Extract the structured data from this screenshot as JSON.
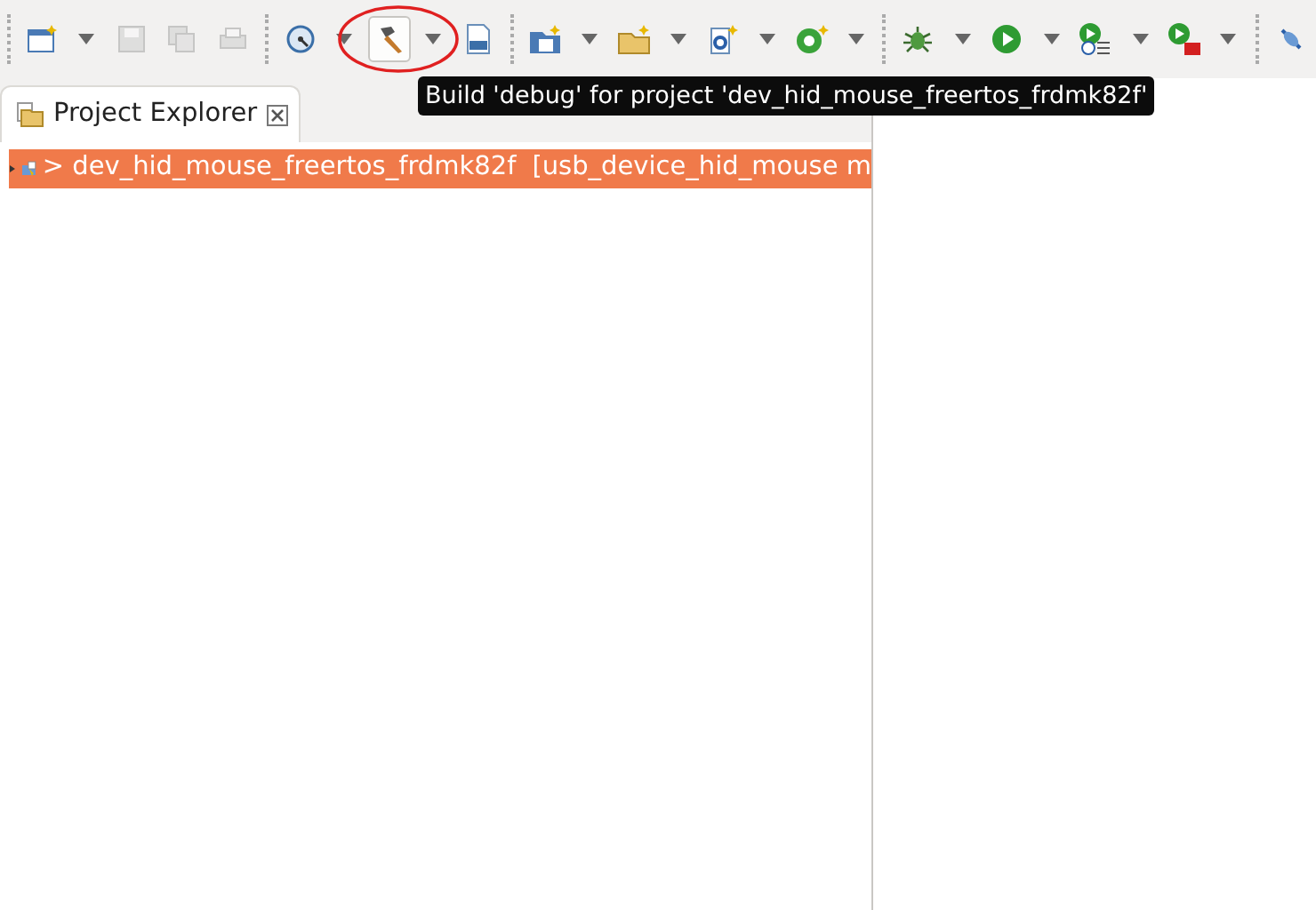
{
  "toolbar": [
    {
      "kind": "separator"
    },
    {
      "kind": "button",
      "disabled": false,
      "hovered": false
    },
    {
      "kind": "caret"
    },
    {
      "kind": "button",
      "disabled": true,
      "hovered": false
    },
    {
      "kind": "button",
      "disabled": true,
      "hovered": false
    },
    {
      "kind": "button",
      "disabled": true,
      "hovered": false
    },
    {
      "kind": "separator"
    },
    {
      "kind": "button",
      "disabled": false,
      "hovered": false
    },
    {
      "kind": "caret"
    },
    {
      "kind": "button",
      "disabled": false,
      "hovered": true
    },
    {
      "kind": "caret"
    },
    {
      "kind": "button",
      "disabled": false,
      "hovered": false
    },
    {
      "kind": "separator"
    },
    {
      "kind": "button",
      "disabled": false,
      "hovered": false
    },
    {
      "kind": "caret"
    },
    {
      "kind": "button",
      "disabled": false,
      "hovered": false
    },
    {
      "kind": "caret"
    },
    {
      "kind": "button",
      "disabled": false,
      "hovered": false
    },
    {
      "kind": "caret"
    },
    {
      "kind": "button",
      "disabled": false,
      "hovered": false
    },
    {
      "kind": "caret"
    },
    {
      "kind": "separator"
    },
    {
      "kind": "button",
      "disabled": false,
      "hovered": false
    },
    {
      "kind": "caret"
    },
    {
      "kind": "button",
      "disabled": false,
      "hovered": false
    },
    {
      "kind": "caret"
    },
    {
      "kind": "button",
      "disabled": false,
      "hovered": false
    },
    {
      "kind": "caret"
    },
    {
      "kind": "button",
      "disabled": false,
      "hovered": false
    },
    {
      "kind": "caret"
    },
    {
      "kind": "separator"
    },
    {
      "kind": "button",
      "disabled": false,
      "hovered": false
    }
  ],
  "tooltip": {
    "text": "Build 'debug' for project 'dev_hid_mouse_freertos_frdmk82f'"
  },
  "explorer": {
    "title": "Project Explorer",
    "tree": [
      {
        "label": "> dev_hid_mouse_freertos_frdmk82f",
        "detail": "[usb_device_hid_mouse m",
        "selected": true,
        "expanded": false
      }
    ]
  }
}
